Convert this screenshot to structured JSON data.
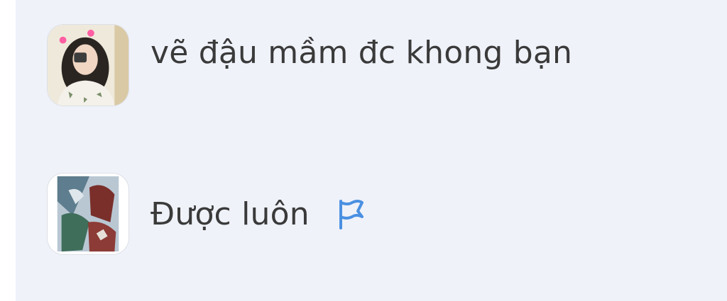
{
  "comments": [
    {
      "text": "vẽ đậu mầm đc khong bạn",
      "avatar_icon": "user-avatar-photo"
    },
    {
      "text": "Được luôn",
      "avatar_icon": "user-avatar-anime",
      "action_icon": "flag-icon"
    }
  ],
  "colors": {
    "panel_background": "#eff2f9",
    "text": "#3a3a3a",
    "flag": "#4a90e2"
  }
}
